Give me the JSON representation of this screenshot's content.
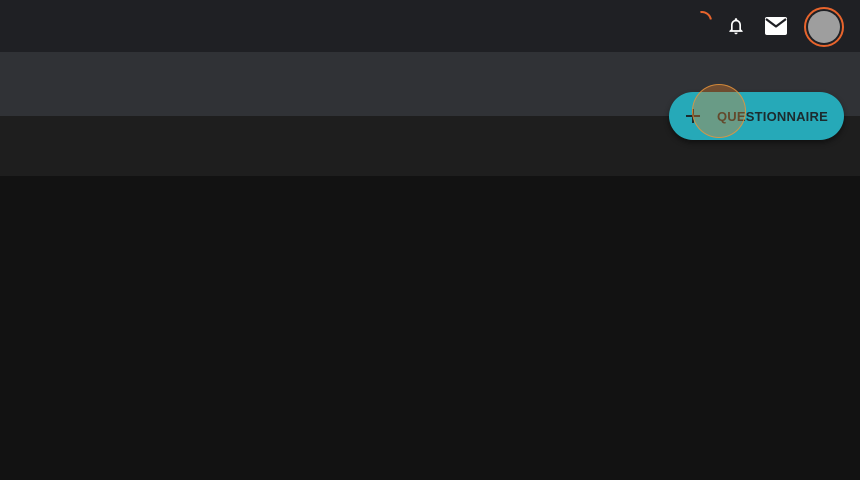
{
  "topbar": {
    "icons": {
      "loading": "loading-spinner",
      "notifications": "bell-icon",
      "messages": "mail-icon",
      "account": "avatar"
    }
  },
  "fab": {
    "label": "QUESTIONNAIRE",
    "icon": "plus-icon"
  },
  "colors": {
    "topbar_bg": "#1f2024",
    "subheader_bg": "#303236",
    "band_bg": "#1e1e1e",
    "page_bg": "#121212",
    "accent": "#26a9b8",
    "highlight": "#e8642c"
  }
}
